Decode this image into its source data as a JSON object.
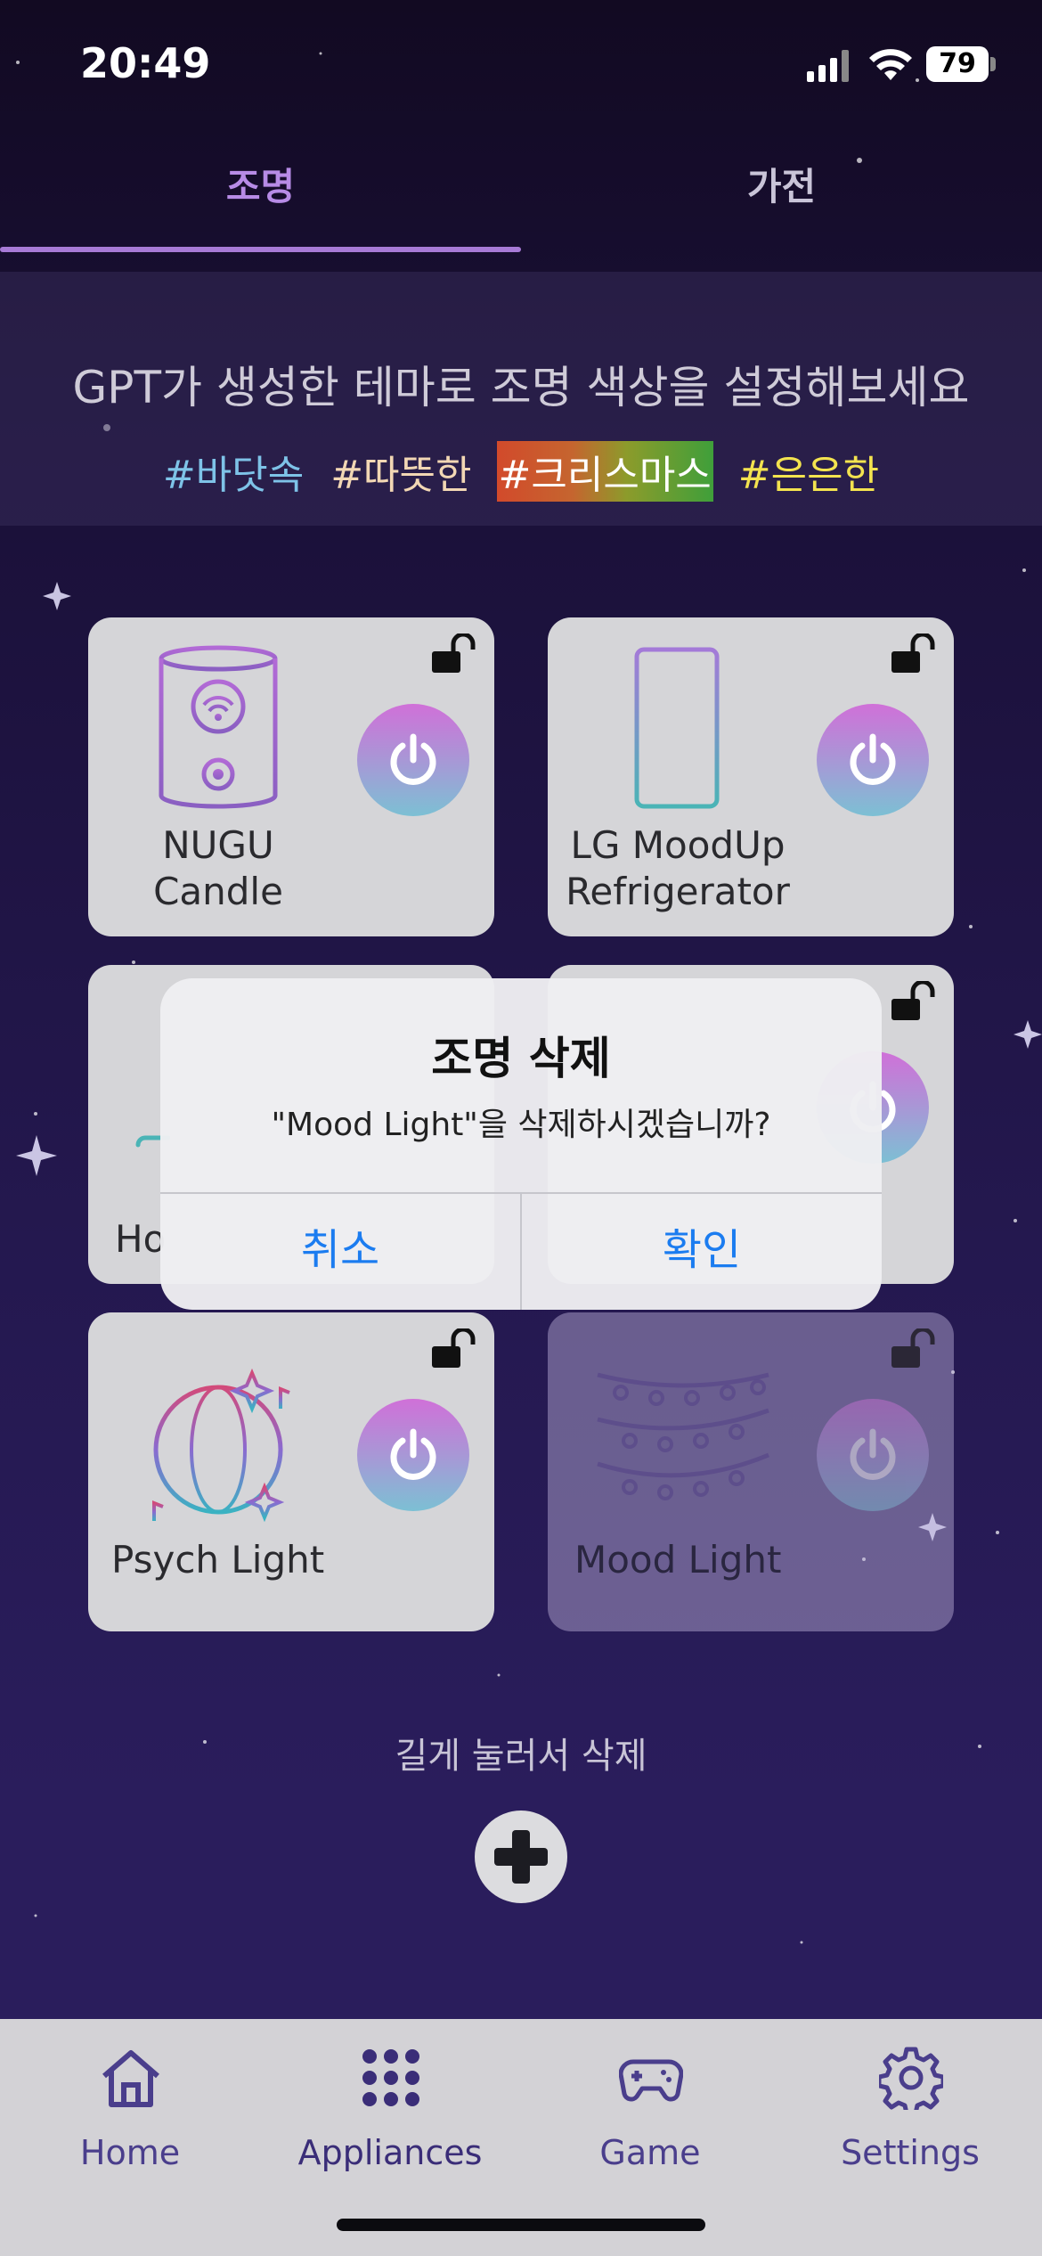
{
  "status_bar": {
    "time": "20:49",
    "battery": "79"
  },
  "tabs": [
    {
      "label": "조명"
    },
    {
      "label": "가전"
    }
  ],
  "banner": {
    "title": "GPT가 생성한 테마로 조명 색상을 설정해보세요",
    "tags": [
      "#바닷속",
      "#따뜻한",
      "#크리스마스",
      "#은은한"
    ]
  },
  "devices": [
    {
      "name_line1": "NUGU",
      "name_line2": "Candle",
      "icon": "candle-speaker-icon",
      "locked": false
    },
    {
      "name_line1": "LG MoodUp",
      "name_line2": "Refrigerator",
      "icon": "refrigerator-icon",
      "locked": false
    },
    {
      "name_line1": "Ho",
      "name_line2": "",
      "icon": "hidden-device-icon",
      "locked": false
    },
    {
      "name_line1": "",
      "name_line2": "",
      "icon": "hidden-device-icon",
      "locked": false
    },
    {
      "name_line1": "Psych Light",
      "name_line2": "",
      "icon": "disco-ball-icon",
      "locked": false
    },
    {
      "name_line1": "Mood Light",
      "name_line2": "",
      "icon": "string-lights-icon",
      "locked": false
    }
  ],
  "alert": {
    "title": "조명 삭제",
    "message": "\"Mood Light\"을 삭제하시겠습니까?",
    "cancel": "취소",
    "confirm": "확인"
  },
  "hint": "길게 눌러서 삭제",
  "bottom_nav": [
    {
      "label": "Home",
      "icon": "home-icon"
    },
    {
      "label": "Appliances",
      "icon": "grid-dots-icon"
    },
    {
      "label": "Game",
      "icon": "gamepad-icon"
    },
    {
      "label": "Settings",
      "icon": "gear-icon"
    }
  ],
  "colors": {
    "accent": "#a77ad6",
    "alert_button": "#1b7cf0",
    "nav_label": "#4a3e8c"
  }
}
